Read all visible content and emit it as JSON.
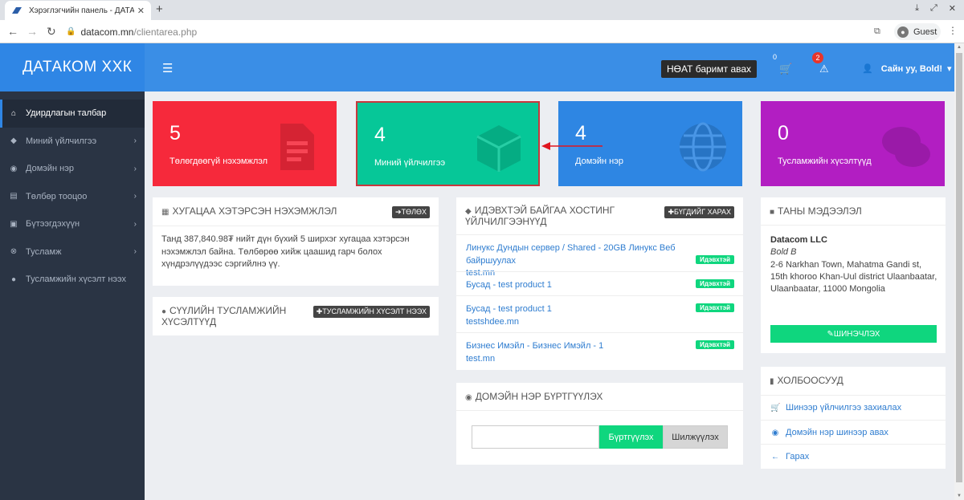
{
  "browser": {
    "tab_title": "Хэрэглэгчийн панель - ДАТАК",
    "url_domain": "datacom.mn",
    "url_path": "/clientarea.php",
    "profile_label": "Guest"
  },
  "header": {
    "logo": "ДАТАКОМ ХХК",
    "vat_button": "НӨАТ баримт авах",
    "cart_count": "0",
    "alert_count": "2",
    "user_greeting": "Сайн уу, Bold!"
  },
  "sidebar": {
    "items": [
      {
        "label": "Удирдлагын талбар",
        "icon": "home-icon"
      },
      {
        "label": "Миний үйлчилгээ",
        "icon": "cube-icon"
      },
      {
        "label": "Домэйн нэр",
        "icon": "globe-icon"
      },
      {
        "label": "Төлбөр тооцоо",
        "icon": "file-icon"
      },
      {
        "label": "Бүтээгдэхүүн",
        "icon": "box-icon"
      },
      {
        "label": "Тусламж",
        "icon": "lifebuoy-icon"
      },
      {
        "label": "Тусламжийн хүсэлт нээх",
        "icon": "comment-icon"
      }
    ]
  },
  "tiles": [
    {
      "value": "5",
      "label": "Төлөгдөөгүй нэхэмжлэл",
      "color": "#f6293b"
    },
    {
      "value": "4",
      "label": "Миний үйлчилгээ",
      "color": "#06c798"
    },
    {
      "value": "4",
      "label": "Домэйн нэр",
      "color": "#2e86e3"
    },
    {
      "value": "0",
      "label": "Тусламжийн хүсэлтүүд",
      "color": "#b21ec2"
    }
  ],
  "overdue": {
    "title": "ХУГАЦАА ХЭТЭРСЭН НЭХЭМЖЛЭЛ",
    "button": "➔ТӨЛӨХ",
    "text": "Танд 387,840.98₮ нийт дүн бүхий 5 ширхэг хугацаа хэтэрсэн нэхэмжлэл байна. Төлбөрөө хийж цаашид гарч болох хүндрэлүүдээс сэргийлнэ үү."
  },
  "tickets": {
    "title": "СҮҮЛИЙН ТУСЛАМЖИЙН ХҮСЭЛТҮҮД",
    "button": "✚ТУСЛАМЖИЙН ХҮСЭЛТ НЭЭХ"
  },
  "hosting": {
    "title": "ИДЭВХТЭЙ БАЙГАА ХОСТИНГ ҮЙЛЧИЛГЭЭНҮҮД",
    "button": "✚БҮГДИЙГ ХАРАХ",
    "items": [
      {
        "name": "Линукс Дундын сервер / Shared - 20GB Линукс Веб байршуулах",
        "domain": "test.mn",
        "status": "Идэвхтэй"
      },
      {
        "name": "Бусад - test product 1",
        "domain": "",
        "status": "Идэвхтэй"
      },
      {
        "name": "Бусад - test product 1",
        "domain": "testshdee.mn",
        "status": "Идэвхтэй"
      },
      {
        "name": "Бизнес Имэйл - Бизнес Имэйл - 1",
        "domain": "test.mn",
        "status": "Идэвхтэй"
      }
    ]
  },
  "domain_reg": {
    "title": "ДОМЭЙН НЭР БҮРТГҮҮЛЭХ",
    "register": "Бүртгүүлэх",
    "transfer": "Шилжүүлэх"
  },
  "info": {
    "title": "ТАНЫ МЭДЭЭЛЭЛ",
    "company": "Datacom LLC",
    "name": "Bold B",
    "address": "2-6 Narkhan Town, Mahatma Gandi st, 15th khoroo Khan-Uul district Ulaanbaatar, Ulaanbaatar, 11000 Mongolia",
    "update_button": "✎ШИНЭЧЛЭХ"
  },
  "links": {
    "title": "ХОЛБООСУУД",
    "items": [
      {
        "label": "Шинээр үйлчилгээ захиалах",
        "icon": "cart-icon"
      },
      {
        "label": "Домэйн нэр шинээр авах",
        "icon": "globe-icon"
      },
      {
        "label": "Гарах",
        "icon": "arrow-left-icon"
      }
    ]
  }
}
